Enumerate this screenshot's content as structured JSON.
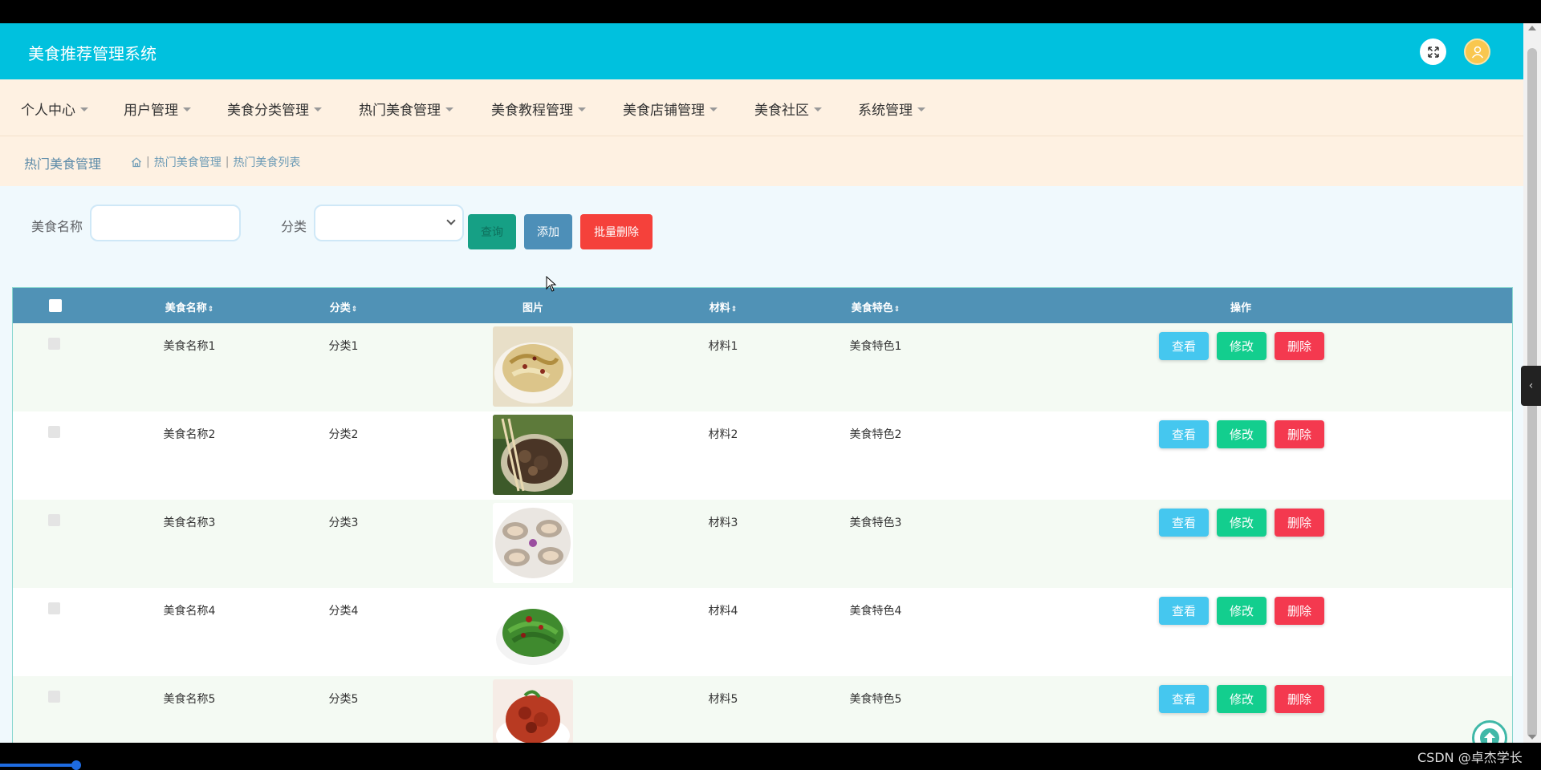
{
  "app": {
    "title": "美食推荐管理系统"
  },
  "nav": [
    {
      "label": "个人中心"
    },
    {
      "label": "用户管理"
    },
    {
      "label": "美食分类管理"
    },
    {
      "label": "热门美食管理"
    },
    {
      "label": "美食教程管理"
    },
    {
      "label": "美食店铺管理"
    },
    {
      "label": "美食社区"
    },
    {
      "label": "系统管理"
    }
  ],
  "breadcrumb": {
    "title": "热门美食管理",
    "items": [
      "热门美食管理",
      "热门美食列表"
    ],
    "separator": "|"
  },
  "search": {
    "name_label": "美食名称",
    "name_value": "",
    "category_label": "分类",
    "category_value": "",
    "query_button": "查询",
    "add_button": "添加",
    "batch_delete_button": "批量删除"
  },
  "table": {
    "columns": [
      "美食名称",
      "分类",
      "图片",
      "材料",
      "美食特色",
      "操作"
    ],
    "sort_glyph": "⇕",
    "rows": [
      {
        "name": "美食名称1",
        "category": "分类1",
        "material": "材料1",
        "feature": "美食特色1",
        "image": "stir-fried-cabbage"
      },
      {
        "name": "美食名称2",
        "category": "分类2",
        "material": "材料2",
        "feature": "美食特色2",
        "image": "braised-meat-bowl"
      },
      {
        "name": "美食名称3",
        "category": "分类3",
        "material": "材料3",
        "feature": "美食特色3",
        "image": "grilled-oysters"
      },
      {
        "name": "美食名称4",
        "category": "分类4",
        "material": "材料4",
        "feature": "美食特色4",
        "image": "green-beans-chili"
      },
      {
        "name": "美食名称5",
        "category": "分类5",
        "material": "材料5",
        "feature": "美食特色5",
        "image": "spicy-chicken"
      }
    ],
    "actions": {
      "view": "查看",
      "edit": "修改",
      "delete": "删除"
    }
  },
  "footer": {
    "watermark": "CSDN @卓杰学长"
  },
  "colors": {
    "header": "#00c1de",
    "nav_bg": "#fef1e2",
    "table_head": "#5092b6",
    "view": "#45c7ef",
    "edit": "#13ce8e",
    "delete": "#f4394f"
  }
}
